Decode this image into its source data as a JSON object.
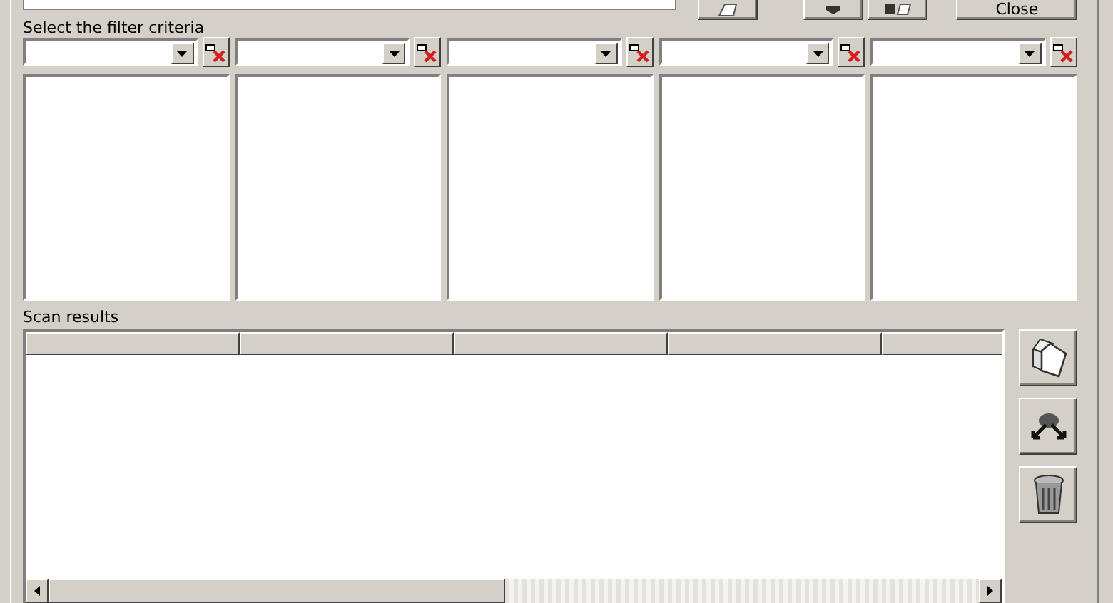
{
  "filter_label": "Select the filter criteria",
  "scan_label": "Scan results",
  "close_button": "Close"
}
